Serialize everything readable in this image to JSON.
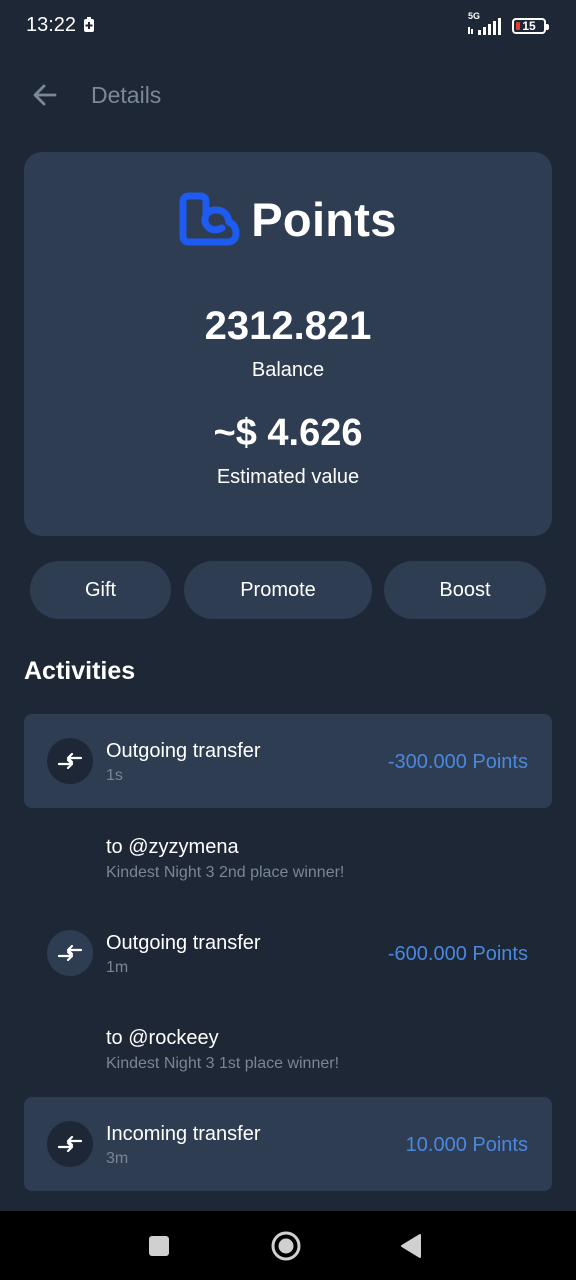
{
  "status_bar": {
    "time": "13:22",
    "network": "5G",
    "battery": "15"
  },
  "header": {
    "title": "Details",
    "back_icon": "arrow-left-icon"
  },
  "card": {
    "brand_name": "Points",
    "brand_logo_color": "#1e5bf0",
    "balance_value": "2312.821",
    "balance_label": "Balance",
    "estimated_value": "~$ 4.626",
    "estimated_label": "Estimated value"
  },
  "actions": [
    {
      "label": "Gift"
    },
    {
      "label": "Promote"
    },
    {
      "label": "Boost"
    }
  ],
  "activities": {
    "title": "Activities",
    "items": [
      {
        "type": "Outgoing transfer",
        "time": "1s",
        "amount": "-300.000 Points",
        "to": "to @zyzymena",
        "memo": "Kindest Night 3 2nd place winner!"
      },
      {
        "type": "Outgoing transfer",
        "time": "1m",
        "amount": "-600.000 Points",
        "to": "to @rockeey",
        "memo": "Kindest Night 3 1st place winner!"
      },
      {
        "type": "Incoming transfer",
        "time": "3m",
        "amount": "10.000 Points"
      }
    ]
  },
  "colors": {
    "background": "#1e2736",
    "card": "#2f3d52",
    "accent": "#4a88e0",
    "muted_text": "#7a8596"
  },
  "nav_bar": {
    "icons": [
      "square-icon",
      "home-circle-icon",
      "back-triangle-icon"
    ]
  }
}
